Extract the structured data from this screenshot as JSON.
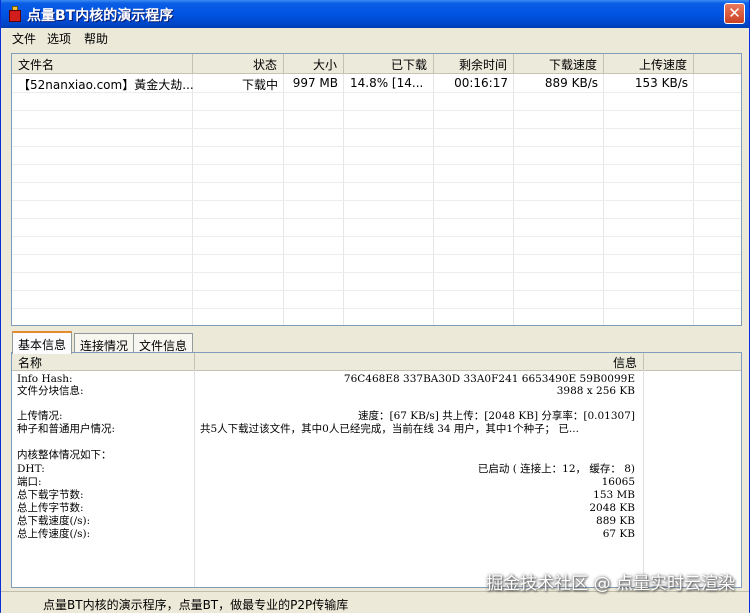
{
  "window": {
    "title": "点量BT内核的演示程序",
    "close_glyph": "✕"
  },
  "menu": {
    "items": [
      "文件",
      "选项",
      "帮助"
    ]
  },
  "task_list": {
    "columns": [
      "文件名",
      "状态",
      "大小",
      "已下载",
      "剩余时间",
      "下载速度",
      "上传速度"
    ],
    "rows": [
      {
        "name": "【52nanxiao.com】黃金大劫...",
        "status": "下载中",
        "size": "997 MB",
        "downloaded": "14.8% [14...",
        "remaining": "00:16:17",
        "down_speed": "889 KB/s",
        "up_speed": "153 KB/s"
      }
    ]
  },
  "tabs": [
    "基本信息",
    "连接情况",
    "文件信息"
  ],
  "detail": {
    "columns": [
      "名称",
      "信息"
    ],
    "rows": [
      {
        "name": "Info Hash:",
        "info": "76C468E8 337BA30D 33A0F241 6653490E 59B0099E"
      },
      {
        "name": "文件分块信息:",
        "info": "3988 x 256 KB"
      },
      {
        "name": "",
        "info": ""
      },
      {
        "name": "上传情况:",
        "info": "速度：[67 KB/s]  共上传：[2048 KB]  分享率：[0.01307]"
      },
      {
        "name": "种子和普通用户情况:",
        "info": "共5人下载过该文件，其中0人已经完成，当前在线 34 用户，其中1个种子；  已..."
      },
      {
        "name": "",
        "info": ""
      },
      {
        "name": "内核整体情况如下：",
        "info": ""
      },
      {
        "name": "DHT:",
        "info": "已启动 ( 连接上：12， 缓存： 8)"
      },
      {
        "name": "端口:",
        "info": "16065"
      },
      {
        "name": "总下载字节数:",
        "info": "153 MB"
      },
      {
        "name": "总上传字节数:",
        "info": "2048 KB"
      },
      {
        "name": "总下载速度(/s):",
        "info": "889 KB"
      },
      {
        "name": "总上传速度(/s):",
        "info": "67 KB"
      }
    ]
  },
  "status_bar": {
    "text": "点量BT内核的演示程序，点量BT，做最专业的P2P传输库"
  },
  "watermark": "掘金技术社区 @ 点量实时云渲染",
  "colors": {
    "titlebar": "#0054e3",
    "window_bg": "#ece9d8",
    "close_button": "#cc4124",
    "active_tab_accent": "#e68b2c"
  }
}
